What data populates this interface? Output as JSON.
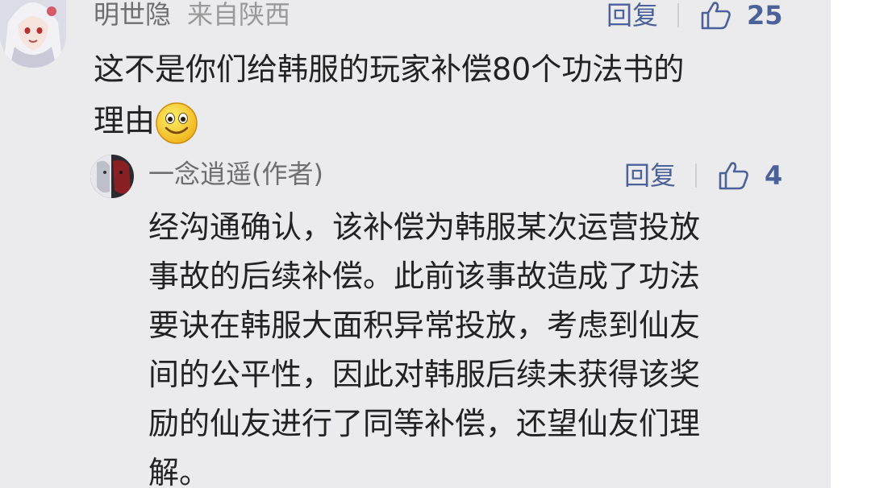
{
  "comment": {
    "user": "明世隐",
    "location": "来自陕西",
    "reply_label": "回复",
    "likes": "25",
    "text_line1": "这不是你们给韩服的玩家补偿80个功法书的",
    "text_line2": "理由",
    "emoji": "smile-emoji"
  },
  "reply": {
    "user": "一念逍遥(作者)",
    "reply_label": "回复",
    "likes": "4",
    "lines": [
      "经沟通确认，该补偿为韩服某次运营投放",
      "事故的后续补偿。此前该事故造成了功法",
      "要诀在韩服大面积异常投放，考虑到仙友",
      "间的公平性，因此对韩服后续未获得该奖",
      "励的仙友进行了同等补偿，还望仙友们理",
      "解。"
    ]
  },
  "colors": {
    "panel_bg": "#ebebed",
    "action_blue": "#4a6199",
    "name_gray": "#6e6e6e",
    "text": "#222222"
  },
  "icons": [
    "thumbs-up-icon",
    "avatar"
  ]
}
